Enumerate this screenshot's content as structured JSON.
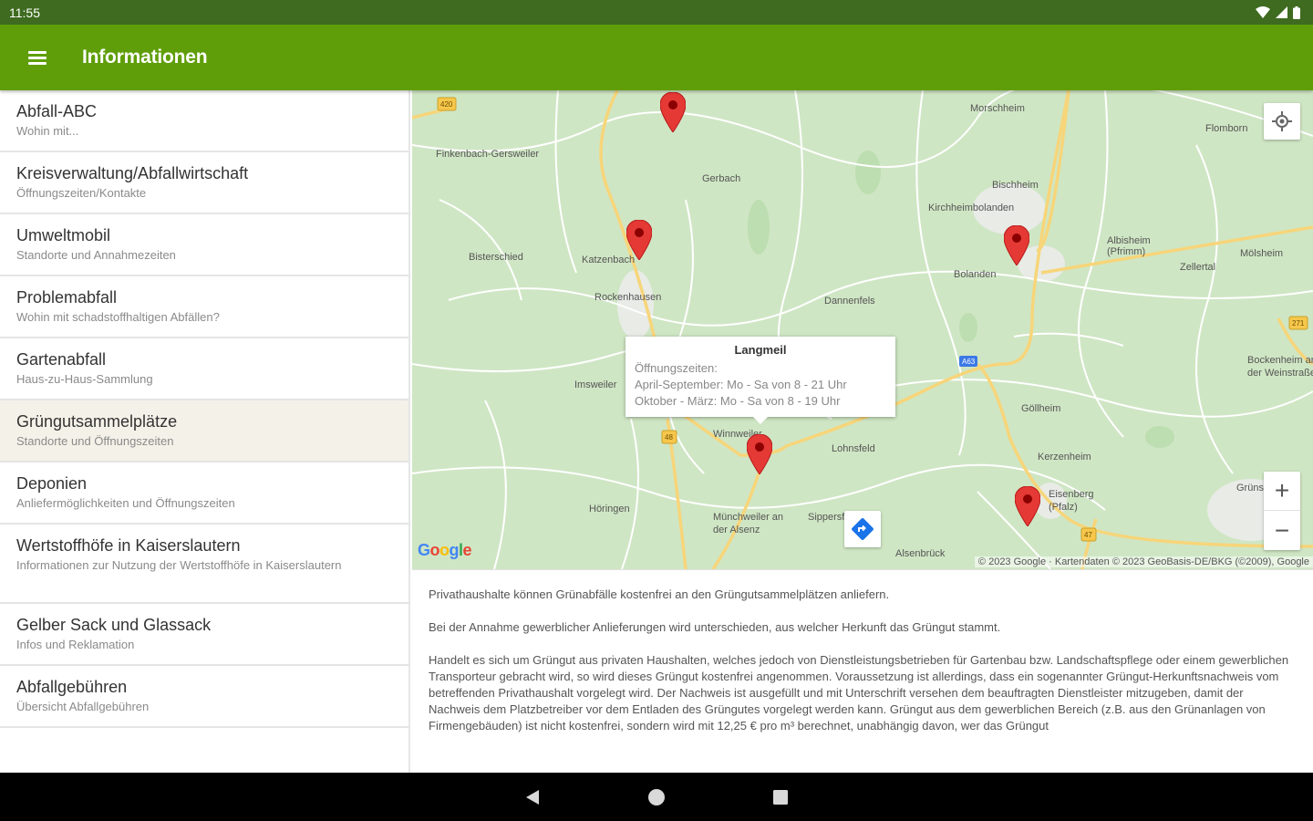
{
  "status_bar": {
    "time": "11:55"
  },
  "app_bar": {
    "title": "Informationen"
  },
  "sidebar": {
    "items": [
      {
        "title": "Abfall-ABC",
        "subtitle": "Wohin mit..."
      },
      {
        "title": "Kreisverwaltung/Abfallwirtschaft",
        "subtitle": "Öffnungszeiten/Kontakte"
      },
      {
        "title": "Umweltmobil",
        "subtitle": "Standorte und Annahmezeiten"
      },
      {
        "title": "Problemabfall",
        "subtitle": "Wohin mit schadstoffhaltigen Abfällen?"
      },
      {
        "title": "Gartenabfall",
        "subtitle": "Haus-zu-Haus-Sammlung"
      },
      {
        "title": "Grüngutsammelplätze",
        "subtitle": "Standorte und Öffnungszeiten",
        "active": true
      },
      {
        "title": "Deponien",
        "subtitle": "Anliefermöglichkeiten und Öffnungszeiten"
      },
      {
        "title": "Wertstoffhöfe in Kaiserslautern",
        "subtitle": "Informationen zur Nutzung der Wertstoffhöfe in Kaiserslautern"
      },
      {
        "title": "Gelber Sack und Glassack",
        "subtitle": "Infos und Reklamation"
      },
      {
        "title": "Abfallgebühren",
        "subtitle": "Übersicht Abfallgebühren"
      }
    ]
  },
  "map": {
    "places": [
      "Morschheim",
      "Flomborn",
      "Finkenbach-Gersweiler",
      "Gerbach",
      "Bischheim",
      "Kirchheimbolanden",
      "Bisterschied",
      "Katzenbach",
      "Albisheim (Pfrimm)",
      "Zellertal",
      "Mölsheim",
      "Bolanden",
      "Rockenhausen",
      "Dannenfels",
      "Bockenheim an der Weinstraße",
      "Imsweiler",
      "Göllheim",
      "Winnweiler",
      "Kerzenheim",
      "Eisenberg (Pfalz)",
      "Münchweiler an der Alsenz",
      "Sippersfeld",
      "Höringen",
      "Lohnsfeld",
      "Alsenbrück",
      "Grünstadt"
    ],
    "road_labels": [
      "420",
      "271",
      "48",
      "47"
    ],
    "info_window": {
      "title": "Langmeil",
      "label": "Öffnungszeiten:",
      "line1": "April-September: Mo - Sa von 8 - 21 Uhr",
      "line2": "Oktober - März: Mo - Sa von 8 - 19 Uhr"
    },
    "google_logo": "Google",
    "attribution": "© 2023 Google · Kartendaten © 2023 GeoBasis-DE/BKG (©2009), Google",
    "zoom_in": "+",
    "zoom_out": "−"
  },
  "content": {
    "p1": "Privathaushalte können Grünabfälle kostenfrei an den Grüngutsammelplätzen anliefern.",
    "p2": "Bei der Annahme gewerblicher Anlieferungen wird unterschieden, aus welcher Herkunft das Grüngut stammt.",
    "p3": "Handelt es sich um Grüngut aus privaten Haushalten, welches jedoch von Dienstleistungsbetrieben für Gartenbau bzw. Landschaftspflege oder einem gewerblichen Transporteur gebracht wird, so wird dieses Grüngut kostenfrei angenommen. Voraussetzung ist allerdings, dass ein sogenannter Grüngut-Herkunftsnachweis vom betreffenden Privathaushalt vorgelegt wird. Der Nachweis ist ausgefüllt und mit Unterschrift versehen dem beauftragten Dienstleister mitzugeben, damit der Nachweis dem Platzbetreiber vor dem Entladen des Grüngutes vorgelegt werden kann. Grüngut aus dem gewerblichen Bereich (z.B. aus den Grünanlagen von Firmengebäuden) ist nicht kostenfrei, sondern wird mit 12,25 € pro m³ berechnet, unabhängig davon, wer das Grüngut"
  },
  "colors": {
    "status_bar": "#3e6b1f",
    "app_bar": "#5f9e08",
    "active_item": "#f4f1e8",
    "map_base": "#cfe6c4",
    "marker": "#e53935"
  }
}
